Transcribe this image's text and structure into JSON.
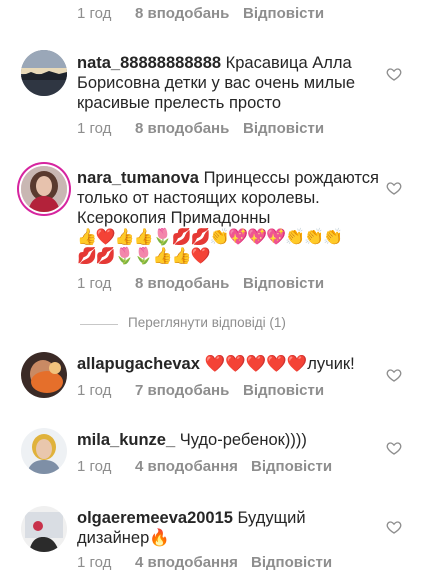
{
  "comments": [
    {
      "time": "1 год",
      "likes": "8 вподобань",
      "reply": "Відповісти"
    },
    {
      "username": "nata_88888888888",
      "text": "Красавица Алла Борисовна детки у вас очень милые красивые прелесть просто",
      "time": "1 год",
      "likes": "8 вподобань",
      "reply": "Відповісти"
    },
    {
      "username": "nara_tumanova",
      "text": "Принцессы рождаются только от настоящих королевы.  Ксерокопия Примадонны",
      "emoji_line1": "👍❤️👍👍🌷💋💋👏💖💖💖👏👏👏",
      "emoji_line2": "💋💋🌷🌷👍👍❤️",
      "time": "1 год",
      "likes": "8 вподобань",
      "reply": "Відповісти",
      "view_replies": "Переглянути відповіді (1)"
    },
    {
      "username": "allapugachevax",
      "text": "❤️❤️❤️❤️❤️лучик!",
      "time": "1 год",
      "likes": "7 вподобань",
      "reply": "Відповісти"
    },
    {
      "username": "mila_kunze_",
      "text": "Чудо-ребенок))))",
      "time": "1 год",
      "likes": "4 вподобання",
      "reply": "Відповісти"
    },
    {
      "username": "olgaeremeeva20015",
      "text": "Будущий дизайнер🔥",
      "time": "1 год",
      "likes": "4 вподобання",
      "reply": "Відповісти"
    }
  ]
}
